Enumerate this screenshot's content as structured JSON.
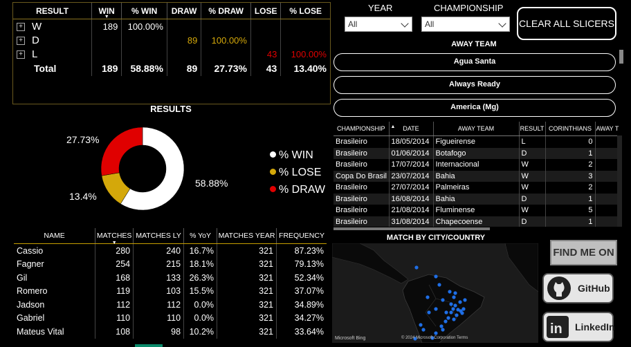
{
  "result_matrix": {
    "headers": [
      "RESULT",
      "WIN",
      "% WIN",
      "DRAW",
      "% DRAW",
      "LOSE",
      "% LOSE"
    ],
    "rows": [
      {
        "label": "W",
        "win": "189",
        "pct_win": "100.00%",
        "draw": "",
        "pct_draw": "",
        "lose": "",
        "pct_lose": ""
      },
      {
        "label": "D",
        "win": "",
        "pct_win": "",
        "draw": "89",
        "pct_draw": "100.00%",
        "lose": "",
        "pct_lose": ""
      },
      {
        "label": "L",
        "win": "",
        "pct_win": "",
        "draw": "",
        "pct_draw": "",
        "lose": "43",
        "pct_lose": "100.00%"
      }
    ],
    "total": {
      "label": "Total",
      "win": "189",
      "pct_win": "58.88%",
      "draw": "89",
      "pct_draw": "27.73%",
      "lose": "43",
      "pct_lose": "13.40%"
    }
  },
  "results_chart": {
    "title": "RESULTS",
    "label_win": "58.88%",
    "label_draw": "27.73%",
    "label_lose": "13.4%",
    "legend": [
      "% WIN",
      "% LOSE",
      "% DRAW"
    ],
    "colors": {
      "win": "#ffffff",
      "lose": "#d4a80a",
      "draw": "#e00000"
    }
  },
  "chart_data": {
    "type": "pie",
    "title": "RESULTS",
    "categories": [
      "% WIN",
      "% LOSE",
      "% DRAW"
    ],
    "values": [
      58.88,
      13.4,
      27.73
    ],
    "legend_position": "right"
  },
  "players": {
    "headers": [
      "NAME",
      "MATCHES",
      "MATCHES LY",
      "% YoY",
      "MATCHES YEAR",
      "FREQUENCY"
    ],
    "rows": [
      [
        "Cassio",
        "280",
        "240",
        "16.7%",
        "321",
        "87.23%"
      ],
      [
        "Fagner",
        "254",
        "215",
        "18.1%",
        "321",
        "79.13%"
      ],
      [
        "Gil",
        "168",
        "133",
        "26.3%",
        "321",
        "52.34%"
      ],
      [
        "Romero",
        "119",
        "103",
        "15.5%",
        "321",
        "37.07%"
      ],
      [
        "Jadson",
        "112",
        "112",
        "0.0%",
        "321",
        "34.89%"
      ],
      [
        "Gabriel",
        "110",
        "110",
        "0.0%",
        "321",
        "34.27%"
      ],
      [
        "Mateus Vital",
        "108",
        "98",
        "10.2%",
        "321",
        "33.64%"
      ]
    ]
  },
  "slicers": {
    "year_label": "YEAR",
    "year_value": "All",
    "championship_label": "CHAMPIONSHIP",
    "championship_value": "All",
    "clear_label": "CLEAR ALL SLICERS"
  },
  "away_team": {
    "title": "AWAY TEAM",
    "items": [
      "Agua Santa",
      "Always Ready",
      "America (Mg)"
    ]
  },
  "matches": {
    "headers": [
      "CHAMPIONSHIP",
      "DATE",
      "AWAY TEAM",
      "RESULT",
      "CORINTHIANS",
      "AWAY T"
    ],
    "rows": [
      [
        "Brasileiro",
        "18/05/2014",
        "Figueirense",
        "L",
        "0",
        ""
      ],
      [
        "Brasileiro",
        "01/06/2014",
        "Botafogo",
        "D",
        "1",
        ""
      ],
      [
        "Brasileiro",
        "17/07/2014",
        "Internacional",
        "W",
        "2",
        ""
      ],
      [
        "Copa Do Brasil",
        "23/07/2014",
        "Bahia",
        "W",
        "3",
        ""
      ],
      [
        "Brasileiro",
        "27/07/2014",
        "Palmeiras",
        "W",
        "2",
        ""
      ],
      [
        "Brasileiro",
        "16/08/2014",
        "Bahia",
        "D",
        "1",
        ""
      ],
      [
        "Brasileiro",
        "21/08/2014",
        "Fluminense",
        "W",
        "5",
        ""
      ],
      [
        "Brasileiro",
        "31/08/2014",
        "Chapecoense",
        "D",
        "1",
        ""
      ]
    ]
  },
  "map": {
    "title": "MATCH BY CITY/COUNTRY",
    "credit": "Microsoft Bing",
    "copyright": "© 2024 Microsoft Corporation  Terms",
    "marker_color": "#1e6ee6"
  },
  "find_me": {
    "label": "FIND ME ON",
    "github": "GitHub",
    "linkedin": "LinkedIn"
  }
}
